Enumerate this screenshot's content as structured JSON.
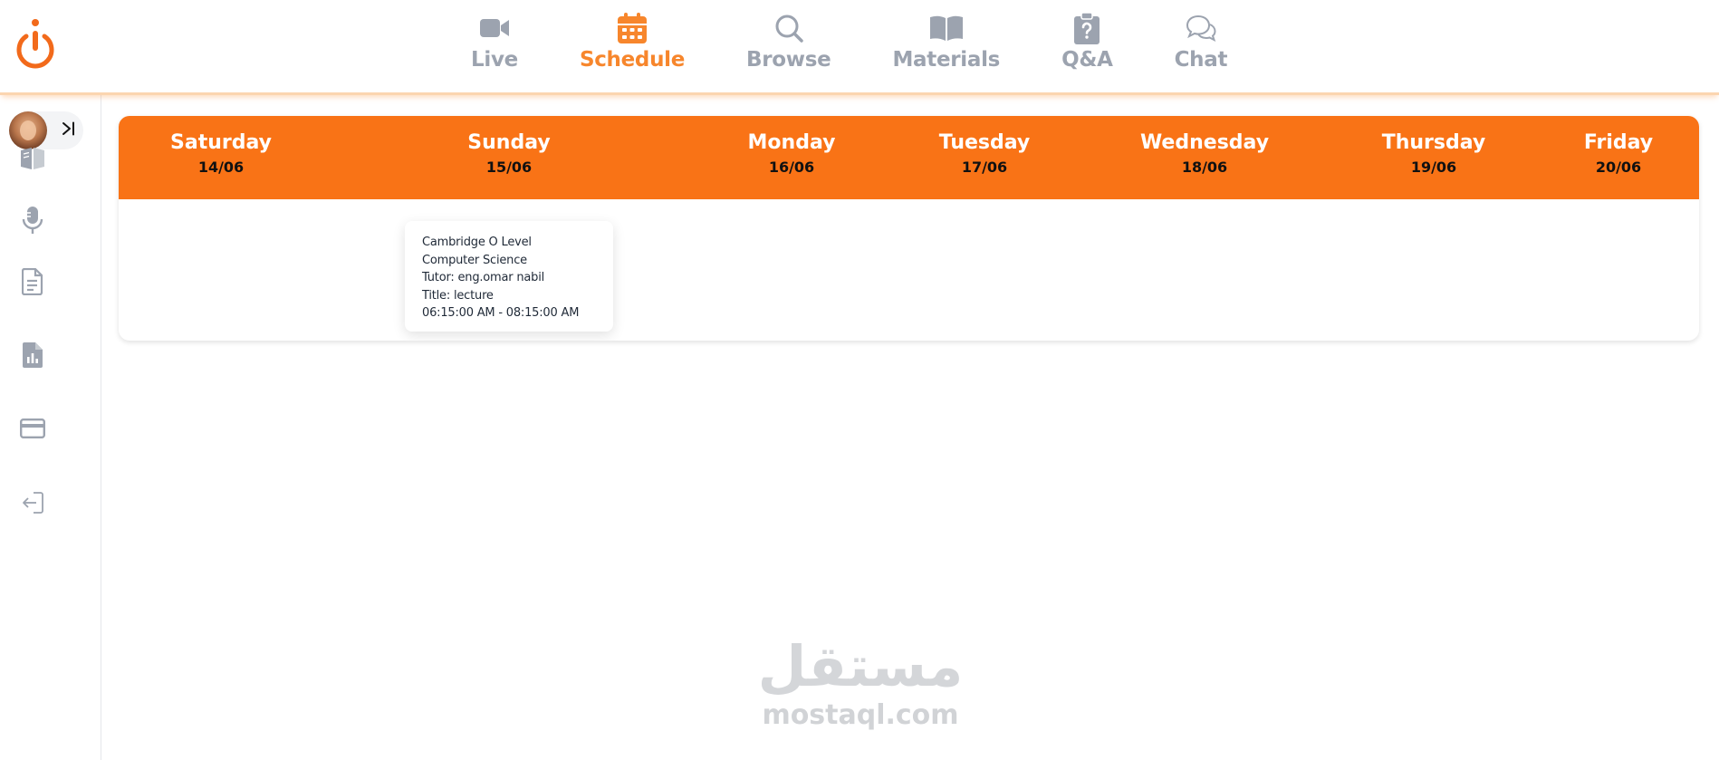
{
  "colors": {
    "accent": "#f97316",
    "active_nav": "#f7862c",
    "inactive_icon": "#9ca3af"
  },
  "header": {
    "logo_icon": "power-icon",
    "nav": [
      {
        "label": "Live",
        "icon": "video-camera-icon",
        "active": false
      },
      {
        "label": "Schedule",
        "icon": "calendar-icon",
        "active": true
      },
      {
        "label": "Browse",
        "icon": "search-icon",
        "active": false
      },
      {
        "label": "Materials",
        "icon": "book-icon",
        "active": false
      },
      {
        "label": "Q&A",
        "icon": "clipboard-question-icon",
        "active": false
      },
      {
        "label": "Chat",
        "icon": "chat-bubbles-icon",
        "active": false
      }
    ]
  },
  "sidebar": {
    "expand_icon": "collapse-arrow-icon",
    "items": [
      {
        "icon": "open-book-icon"
      },
      {
        "icon": "microphone-icon"
      },
      {
        "icon": "document-icon"
      },
      {
        "icon": "report-chart-icon"
      },
      {
        "icon": "credit-card-icon"
      },
      {
        "icon": "logout-icon"
      }
    ]
  },
  "schedule": {
    "days": [
      {
        "name": "Saturday",
        "date": "14/06"
      },
      {
        "name": "Sunday",
        "date": "15/06"
      },
      {
        "name": "Monday",
        "date": "16/06"
      },
      {
        "name": "Tuesday",
        "date": "17/06"
      },
      {
        "name": "Wednesday",
        "date": "18/06"
      },
      {
        "name": "Thursday",
        "date": "19/06"
      },
      {
        "name": "Friday",
        "date": "20/06"
      }
    ],
    "events": [
      {
        "day": "Sunday",
        "course_line1": "Cambridge O Level",
        "course_line2": "Computer Science",
        "tutor": "Tutor: eng.omar nabil",
        "title": "Title: lecture",
        "time": "06:15:00 AM - 08:15:00 AM"
      }
    ]
  },
  "watermark": {
    "arabic": "مستقل",
    "latin": "mostaql.com"
  }
}
